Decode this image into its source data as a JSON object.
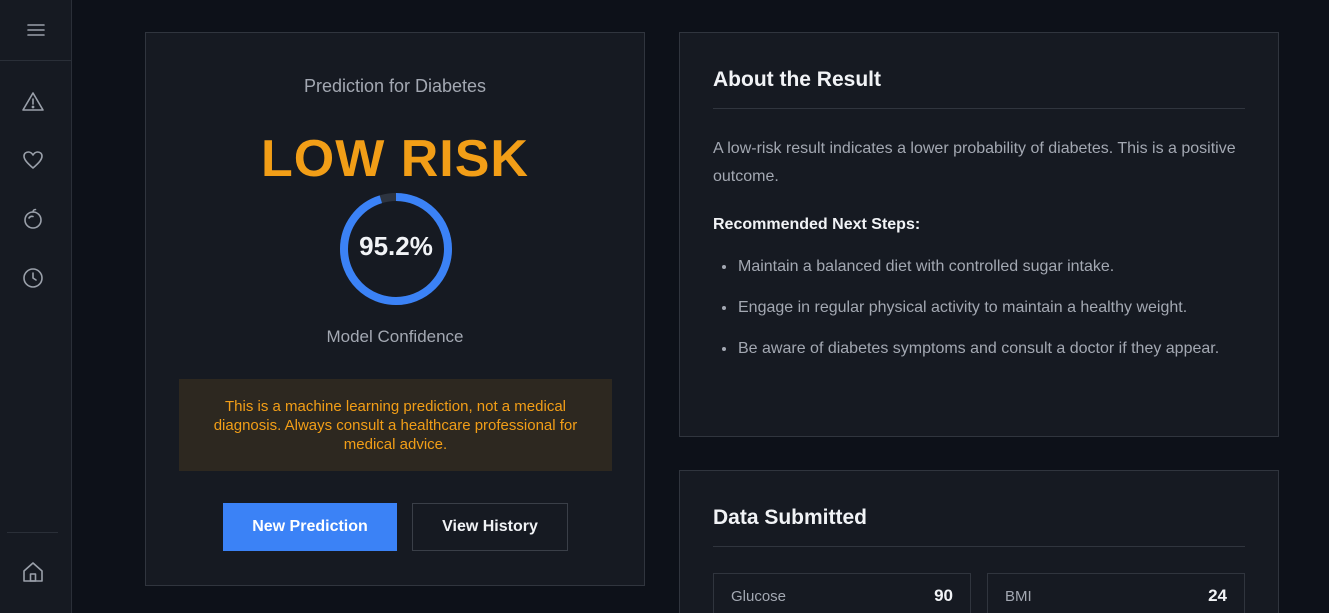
{
  "sidebar": {
    "items": [
      {
        "icon": "alert-triangle-icon"
      },
      {
        "icon": "heart-icon"
      },
      {
        "icon": "apple-icon"
      },
      {
        "icon": "clock-icon"
      }
    ],
    "bottom": {
      "icon": "home-icon"
    }
  },
  "prediction": {
    "title": "Prediction for Diabetes",
    "risk_label": "LOW RISK",
    "confidence_text": "95.2%",
    "confidence_value": 95.2,
    "confidence_label": "Model Confidence",
    "disclaimer": "This is a machine learning prediction, not a medical diagnosis. Always consult a healthcare professional for medical advice.",
    "new_prediction_label": "New Prediction",
    "view_history_label": "View History"
  },
  "about": {
    "heading": "About the Result",
    "text": "A low-risk result indicates a lower probability of diabetes. This is a positive outcome.",
    "steps_heading": "Recommended Next Steps:",
    "steps": [
      "Maintain a balanced diet with controlled sugar intake.",
      "Engage in regular physical activity to maintain a healthy weight.",
      "Be aware of diabetes symptoms and consult a doctor if they appear."
    ]
  },
  "data_submitted": {
    "heading": "Data Submitted",
    "fields": [
      {
        "label": "Glucose",
        "value": "90"
      },
      {
        "label": "BMI",
        "value": "24"
      }
    ]
  },
  "colors": {
    "accent": "#3b82f6",
    "risk": "#f29e17",
    "background": "#0d1119",
    "card": "#161a22"
  }
}
